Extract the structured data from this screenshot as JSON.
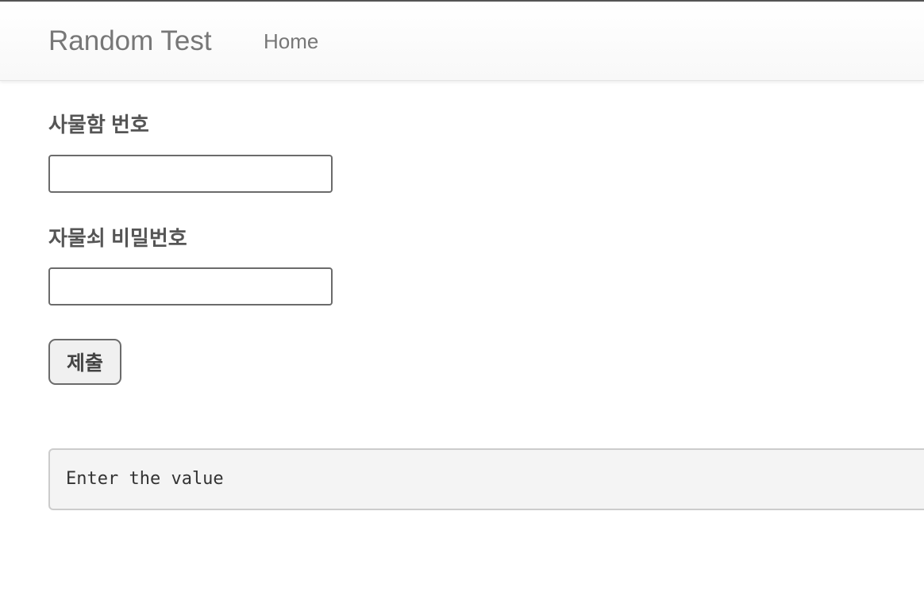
{
  "navbar": {
    "brand": "Random Test",
    "home_link": "Home"
  },
  "form": {
    "locker_number_label": "사물함 번호",
    "locker_number_value": "",
    "password_label": "자물쇠 비밀번호",
    "password_value": "",
    "submit_label": "제출"
  },
  "result": {
    "text": "Enter the value"
  }
}
